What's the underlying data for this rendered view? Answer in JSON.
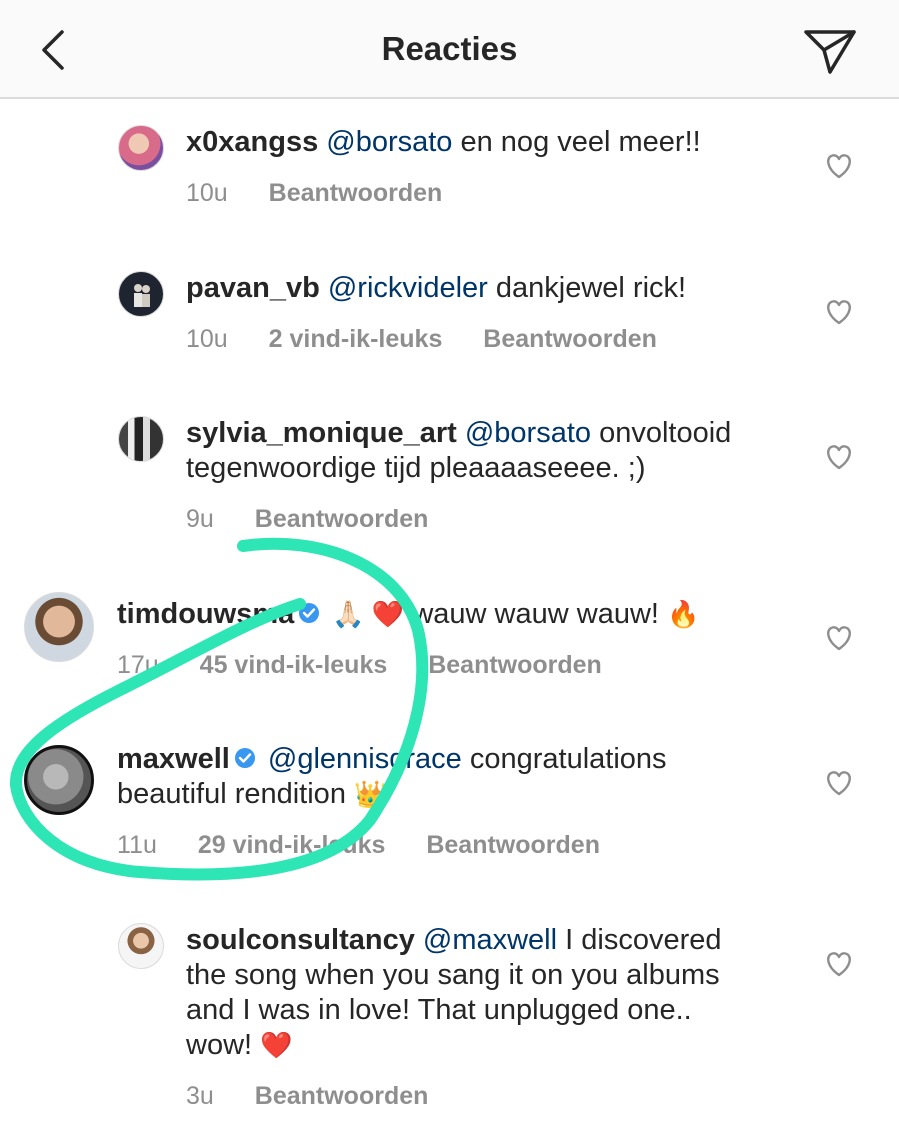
{
  "header": {
    "title": "Reacties"
  },
  "comments": [
    {
      "user": "x0xangss",
      "mention": "@borsato",
      "text": " en nog veel meer!!",
      "text2": "",
      "time": "10u",
      "likes": "",
      "reply": "Beantwoorden"
    },
    {
      "user": "pavan_vb",
      "mention": "@rickvideler",
      "text": " dankjewel rick!",
      "text2": "",
      "time": "10u",
      "likes": "2 vind-ik-leuks",
      "reply": "Beantwoorden"
    },
    {
      "user": "sylvia_monique_art",
      "mention": "@borsato",
      "text": " onvoltooid",
      "text2": "tegenwoordige tijd pleaaaaseeee. ;)",
      "time": "9u",
      "likes": "",
      "reply": "Beantwoorden"
    },
    {
      "user": "timdouwsma",
      "mention": "",
      "text": "wauw wauw wauw!",
      "emoji_before": "🙏🏻 ❤️",
      "emoji_after": "🔥",
      "text2": "",
      "time": "17u",
      "likes": "45 vind-ik-leuks",
      "reply": "Beantwoorden"
    },
    {
      "user": "maxwell",
      "mention": "@glennisgrace",
      "text": " congratulations",
      "text2": "beautiful rendition",
      "emoji_after": "👑",
      "time": "11u",
      "likes": "29 vind-ik-leuks",
      "reply": "Beantwoorden"
    },
    {
      "user": "soulconsultancy",
      "mention": "@maxwell",
      "text": " I discovered",
      "text2": "the song when you sang it on you albums",
      "text3": "and I was in love! That unplugged one..",
      "text4": "wow!",
      "emoji_after": "❤️",
      "time": "3u",
      "likes": "",
      "reply": "Beantwoorden"
    }
  ],
  "colors": {
    "annotation": "#2ee5b5",
    "mention": "#003569",
    "verified": "#3897f0",
    "meta": "#8e8e8e"
  },
  "icons": {
    "back": "chevron-left-icon",
    "send": "paper-plane-icon",
    "like": "heart-outline-icon",
    "verified": "verified-badge-icon"
  }
}
